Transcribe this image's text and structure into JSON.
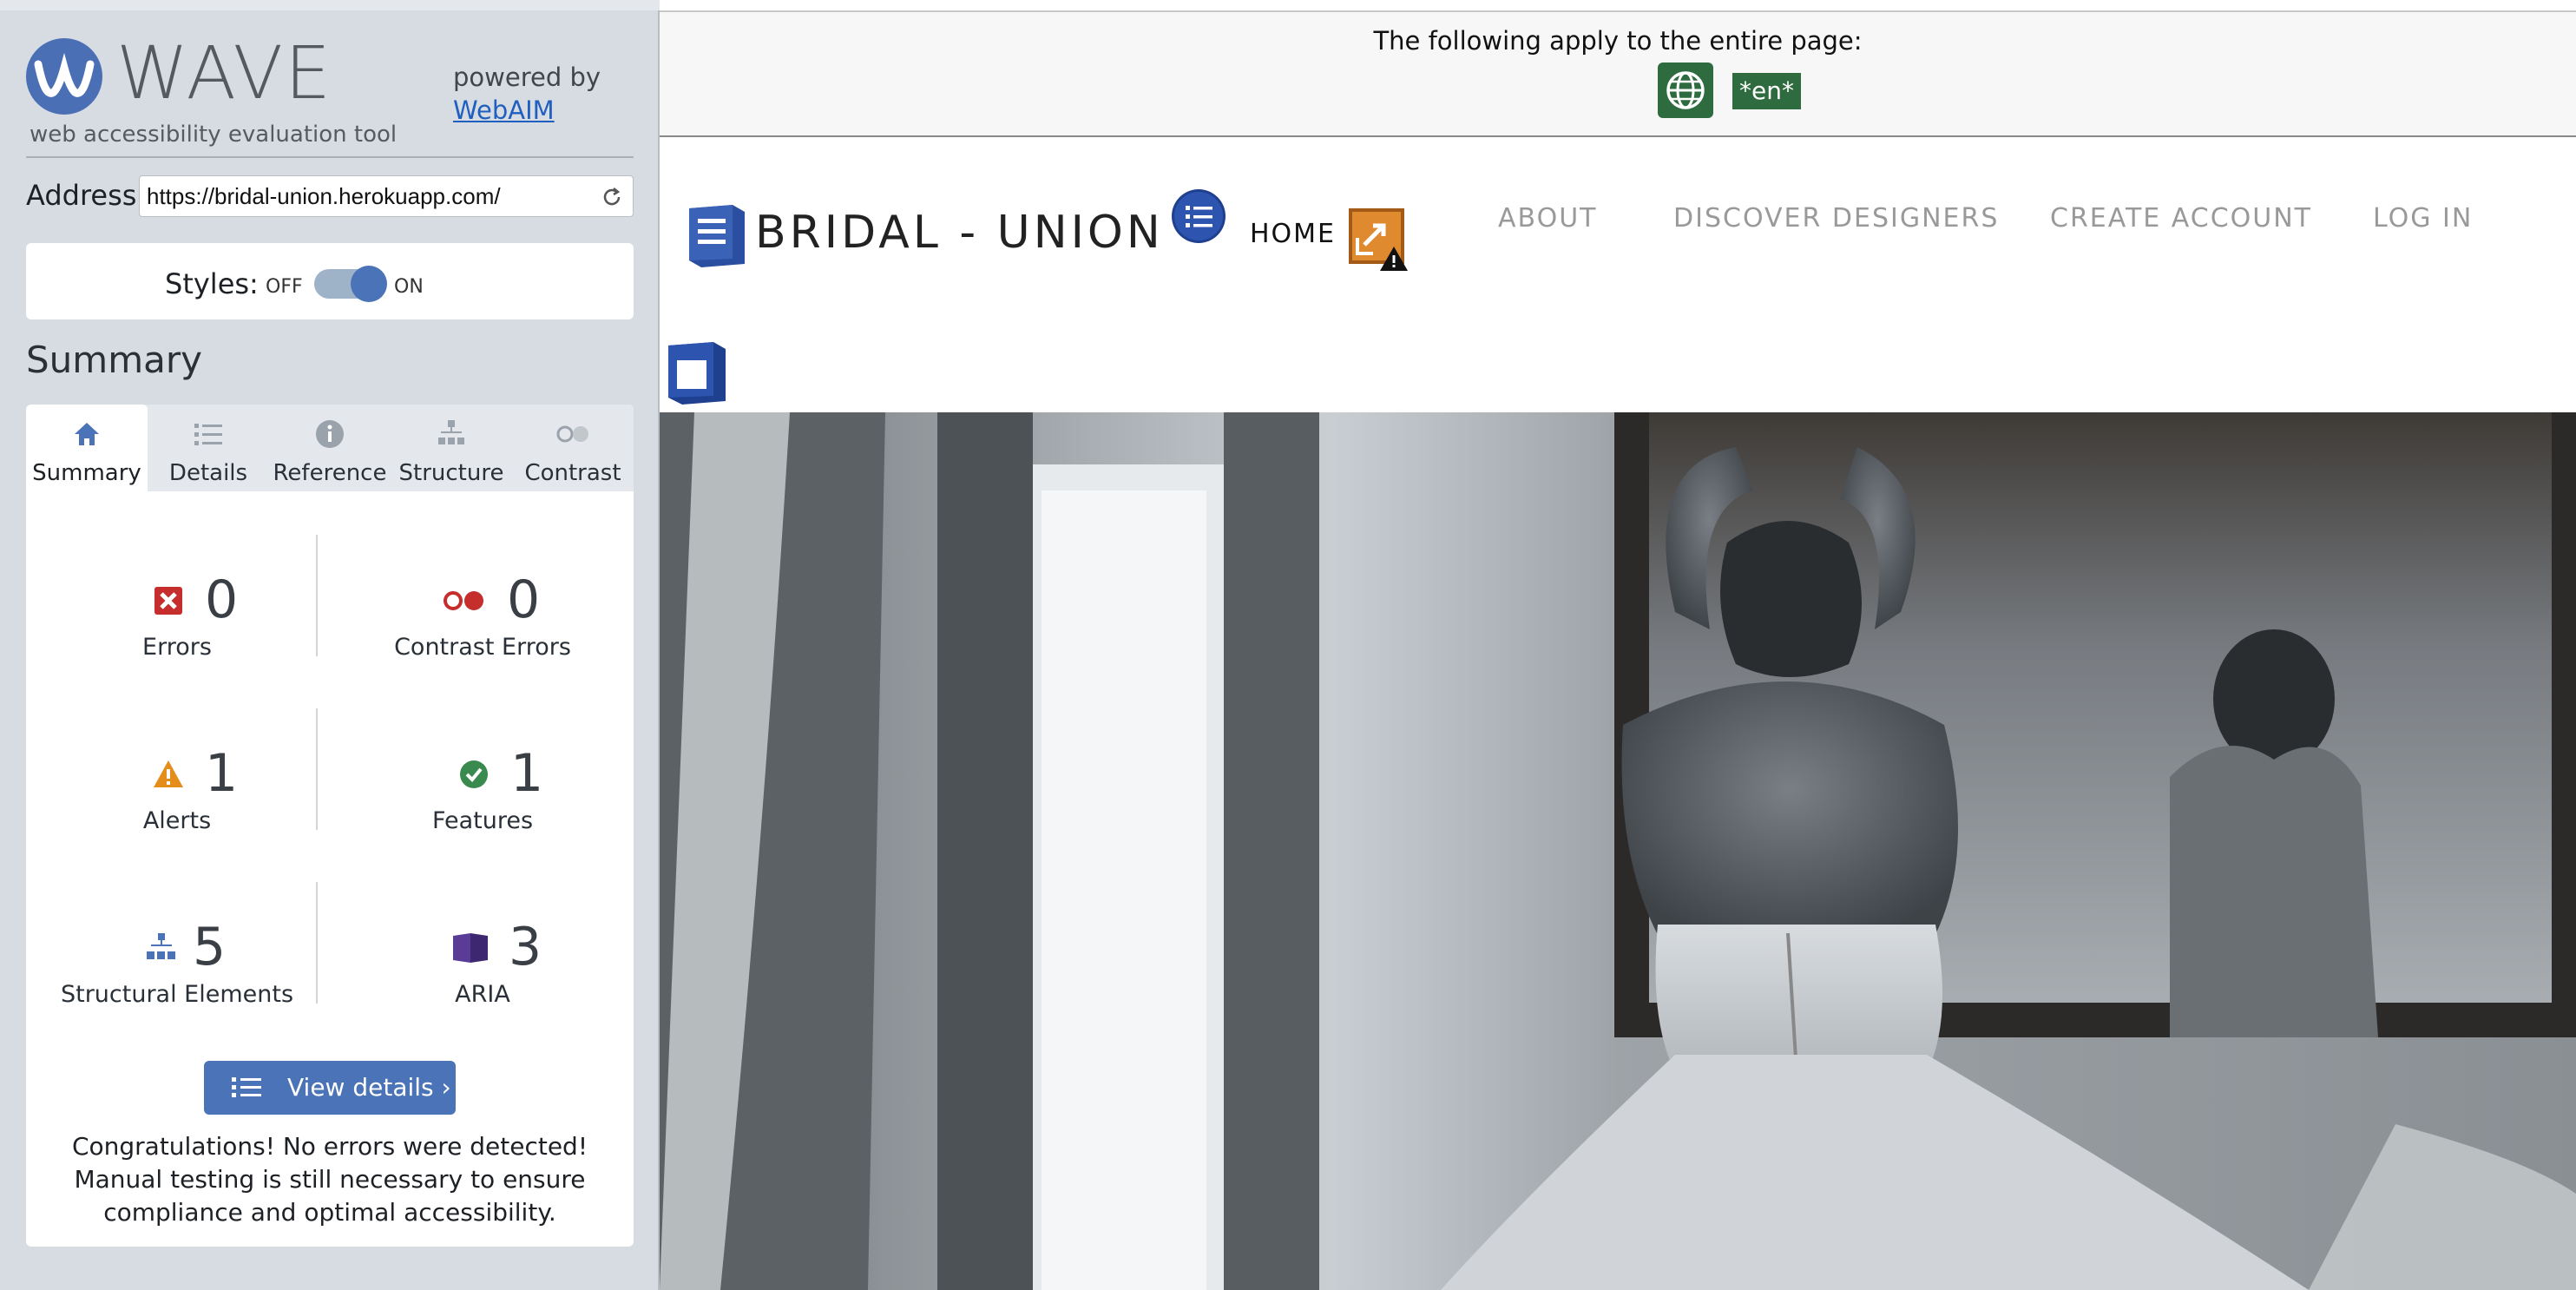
{
  "sidebar": {
    "logo_title": "WAVE",
    "logo_subtitle": "web accessibility evaluation tool",
    "powered_by": "powered by",
    "webaim_link": "WebAIM",
    "address_label": "Address:",
    "address_value": "https://bridal-union.herokuapp.com/",
    "styles_label": "Styles:",
    "styles_off": "OFF",
    "styles_on": "ON",
    "styles_enabled": true,
    "summary_heading": "Summary",
    "tabs": [
      {
        "label": "Summary",
        "icon": "home-icon",
        "active": true
      },
      {
        "label": "Details",
        "icon": "list-icon",
        "active": false
      },
      {
        "label": "Reference",
        "icon": "info-icon",
        "active": false
      },
      {
        "label": "Structure",
        "icon": "hierarchy-icon",
        "active": false
      },
      {
        "label": "Contrast",
        "icon": "contrast-icon",
        "active": false
      }
    ],
    "stats": {
      "errors": {
        "count": "0",
        "label": "Errors",
        "color": "#c62d2d"
      },
      "contrast_errors": {
        "count": "0",
        "label": "Contrast Errors",
        "color": "#c62d2d"
      },
      "alerts": {
        "count": "1",
        "label": "Alerts",
        "color": "#e58d1a"
      },
      "features": {
        "count": "1",
        "label": "Features",
        "color": "#3a8a4f"
      },
      "structural": {
        "count": "5",
        "label": "Structural Elements",
        "color": "#4a73b8"
      },
      "aria": {
        "count": "3",
        "label": "ARIA",
        "color": "#5a3c96"
      }
    },
    "view_details_button": "View details ›",
    "congrats_text": "Congratulations! No errors were detected! Manual testing is still necessary to ensure compliance and optimal accessibility."
  },
  "main": {
    "global_text": "The following apply to the entire page:",
    "lang_badge": "*en*",
    "brand": "BRIDAL - UNION",
    "nav": {
      "home": "HOME",
      "about": "ABOUT",
      "discover": "DISCOVER DESIGNERS",
      "create": "CREATE ACCOUNT",
      "login": "LOG IN"
    }
  },
  "colors": {
    "wave_blue": "#4a73b8",
    "feature_green": "#2e6b3f",
    "alert_orange": "#d9822b",
    "sidebar_bg": "#d6dce2"
  }
}
